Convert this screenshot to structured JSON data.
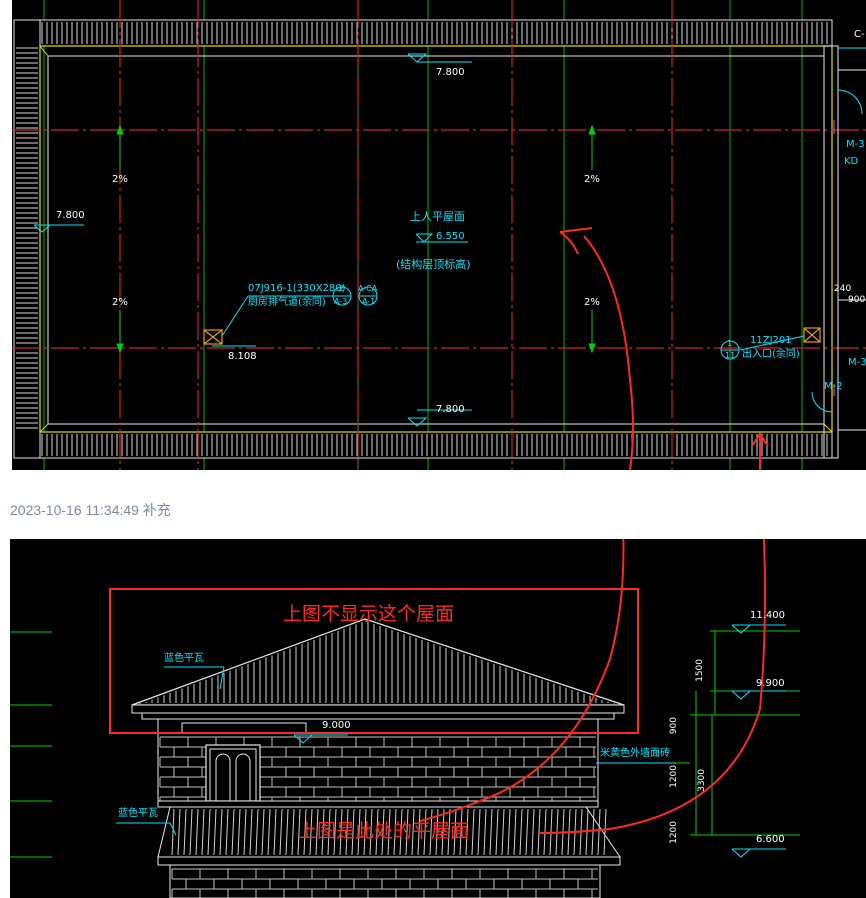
{
  "top_plan": {
    "elevations": {
      "top_center": "7.800",
      "bottom_center": "7.800",
      "left_side": "7.800",
      "roof_center": "6.550",
      "vent_level": "8.108"
    },
    "slopes": [
      "2%",
      "2%",
      "2%",
      "2%"
    ],
    "roof_title": "上人平屋面",
    "roof_note": "(结构层顶标高)",
    "vent_code": "07J916-1(330X280)",
    "vent_label": "厨房排气道(余同)",
    "vent_tag_top": "2",
    "vent_tag_bottom": "A-3",
    "vent_tag2_top": "A-CA",
    "vent_tag2_bottom": "A-1",
    "exit_code": "11ZJ201",
    "exit_label": "出入口(余同)",
    "exit_tag_top": "1",
    "exit_tag_bottom": "11",
    "right_labels": [
      "C-",
      "M-3",
      "KD",
      "240",
      "900",
      "M-3",
      "M-2"
    ]
  },
  "timestamp": "2023-10-16 11:34:49 补充",
  "bottom_elevation": {
    "annotation_top": "上图不显示这个屋面",
    "annotation_bottom": "上图是此处的平屋面",
    "roof_label_top": "蓝色平瓦",
    "roof_label_lower": "蓝色平瓦",
    "wall_label": "米黄色外墙面砖",
    "levels": [
      "11.400",
      "9.900",
      "9.000",
      "6.600"
    ],
    "dims": [
      "1500",
      "900",
      "3300",
      "1200",
      "1200"
    ]
  },
  "colors": {
    "background": "#000000",
    "grid_red": "#d0202a",
    "cyan": "#00e5ff",
    "yellow": "#e6e000",
    "green": "#00d000",
    "annotation_red": "#ff2a1f",
    "timestamp": "#7c8aa5"
  }
}
